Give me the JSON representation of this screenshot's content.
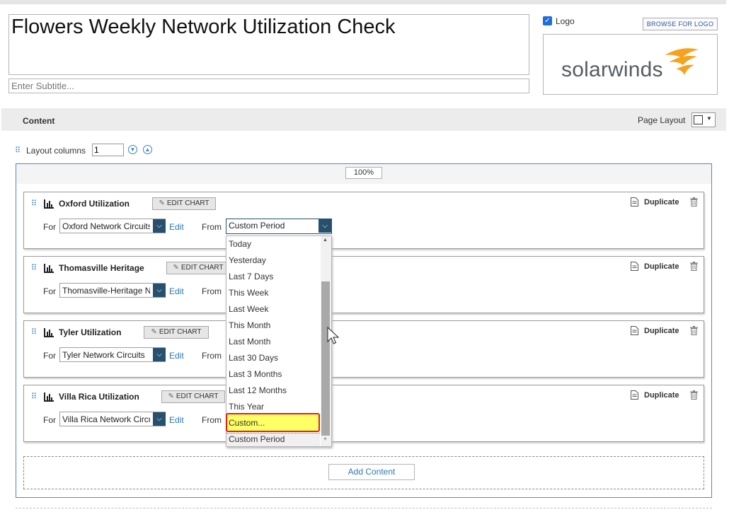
{
  "header": {
    "title": "Flowers Weekly Network Utilization Check",
    "subtitle_placeholder": "Enter Subtitle...",
    "logo_checkbox_label": "Logo",
    "browse_logo_label": "BROWSE FOR LOGO",
    "logo_text": "solarwinds"
  },
  "content_bar": {
    "label": "Content",
    "page_layout_label": "Page Layout"
  },
  "layout": {
    "columns_label": "Layout columns",
    "columns_value": "1",
    "width_percent": "100%"
  },
  "cards": [
    {
      "title": "Oxford Utilization",
      "edit_chart": "EDIT CHART",
      "for_label": "For",
      "for_value": "Oxford Network Circuits",
      "edit_link": "Edit",
      "from_label": "From",
      "from_value": "Custom Period",
      "duplicate": "Duplicate"
    },
    {
      "title": "Thomasville Heritage",
      "edit_chart": "EDIT CHART",
      "for_label": "For",
      "for_value": "Thomasville-Heritage N",
      "edit_link": "Edit",
      "from_label": "From",
      "duplicate": "Duplicate"
    },
    {
      "title": "Tyler Utilization",
      "edit_chart": "EDIT CHART",
      "for_label": "For",
      "for_value": "Tyler Network Circuits",
      "edit_link": "Edit",
      "from_label": "From",
      "duplicate": "Duplicate"
    },
    {
      "title": "Villa Rica Utilization",
      "edit_chart": "EDIT CHART",
      "for_label": "For",
      "for_value": "Villa Rica Network Circu",
      "edit_link": "Edit",
      "from_label": "From",
      "duplicate": "Duplicate"
    }
  ],
  "period_dropdown": {
    "options": [
      "Today",
      "Yesterday",
      "Last 7 Days",
      "This Week",
      "Last Week",
      "This Month",
      "Last Month",
      "Last 30 Days",
      "Last 3 Months",
      "Last 12 Months",
      "This Year",
      "Custom...",
      "Custom Period"
    ],
    "highlighted": "Custom...",
    "selected": "Custom Period"
  },
  "add_content_label": "Add Content",
  "colors": {
    "accent_blue": "#2c78b3",
    "select_arrow_bg": "#27506e",
    "highlight_yellow": "#ffff66",
    "highlight_border": "#e3201a",
    "logo_orange": "#f5a21c"
  },
  "icons": {
    "chart": "bar-chart-icon",
    "duplicate": "document-icon",
    "delete": "trash-icon",
    "edit": "pencil-icon",
    "drag": "drag-handle-icon"
  }
}
